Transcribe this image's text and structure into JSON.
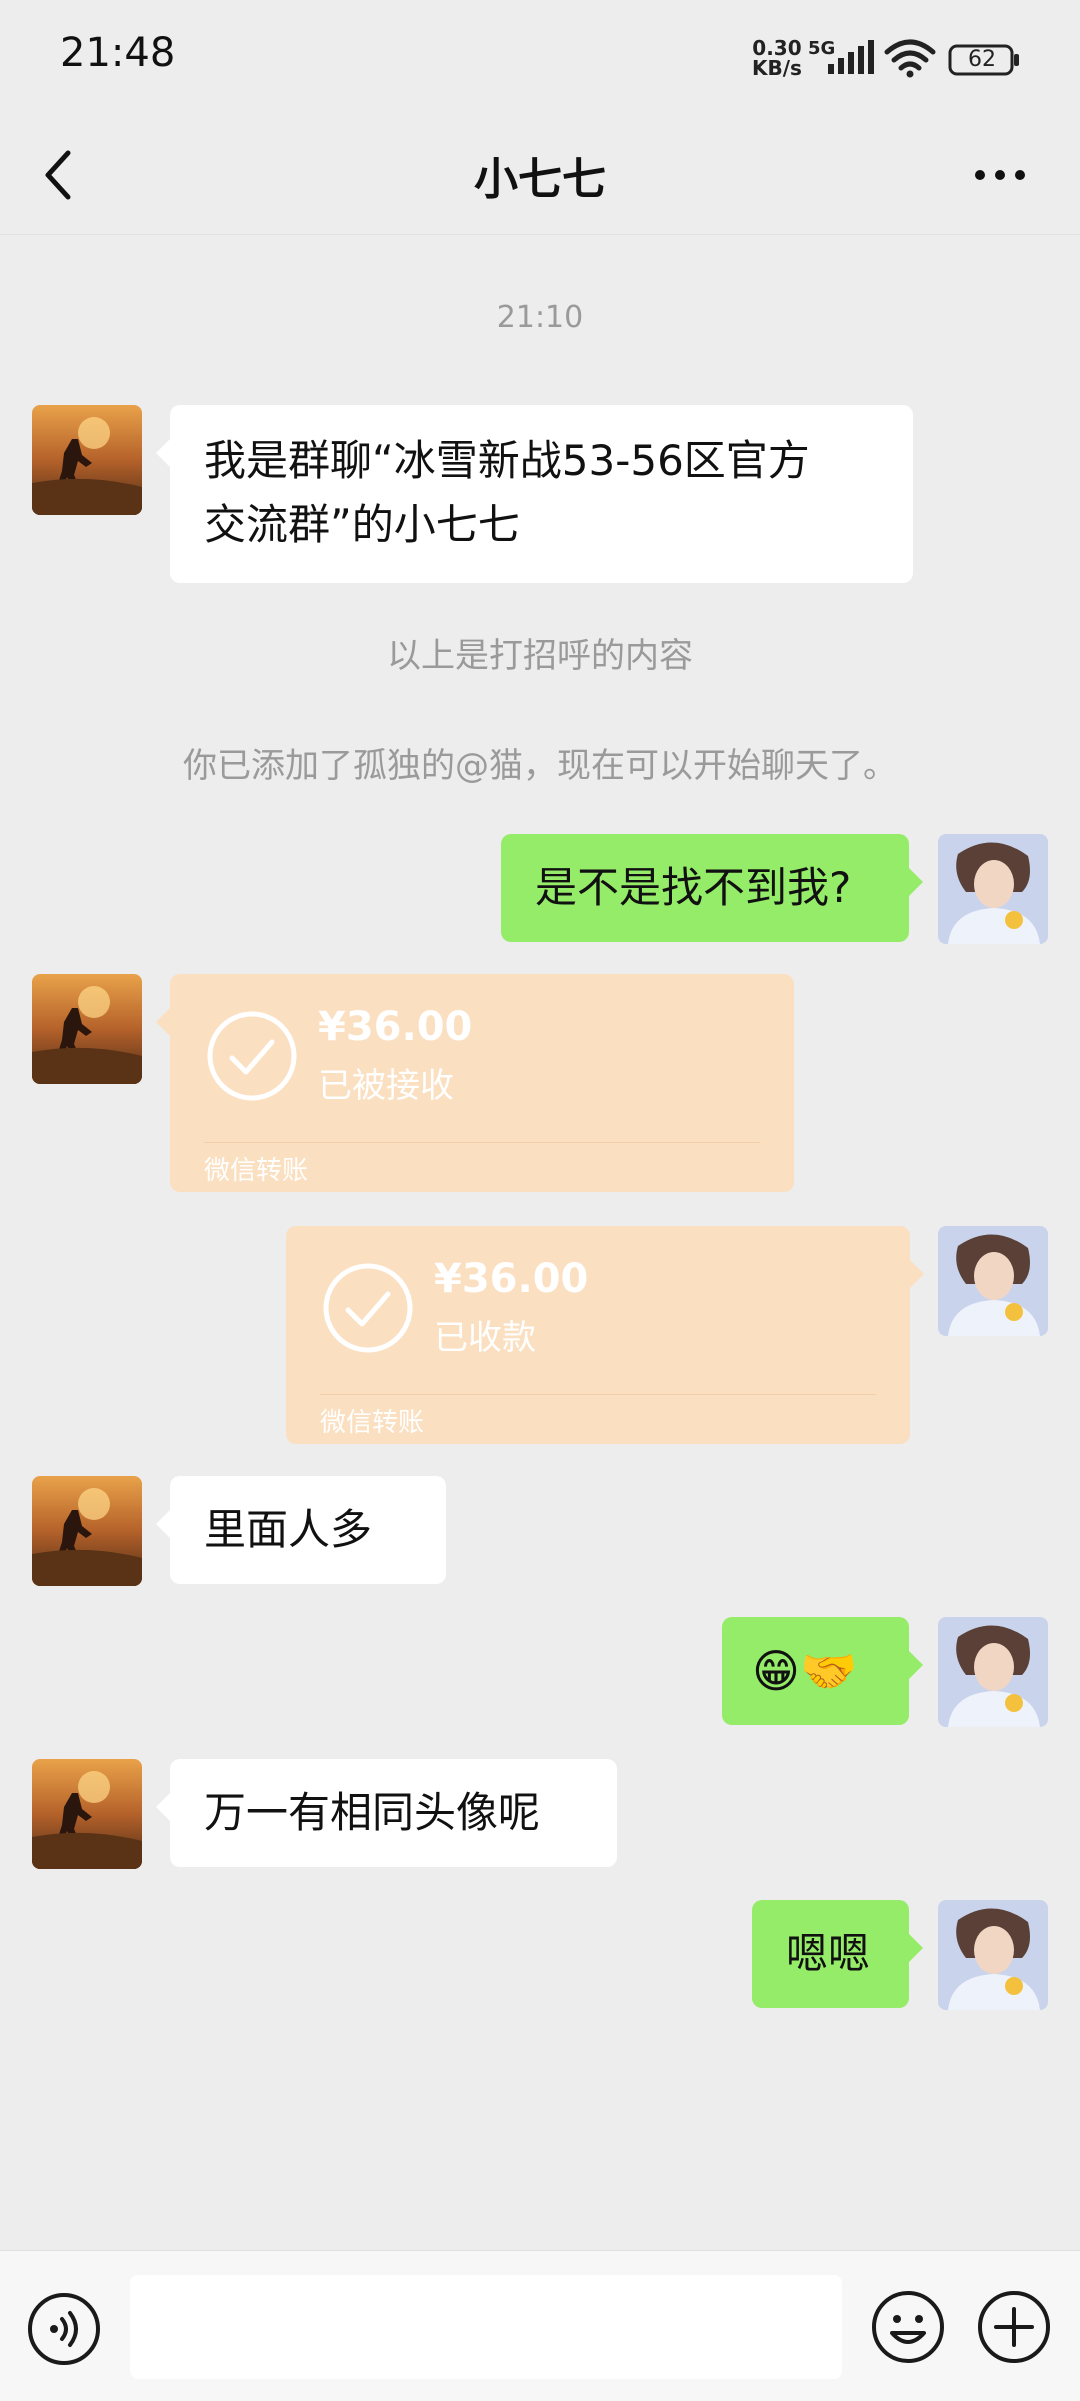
{
  "status_bar": {
    "time": "21:48",
    "net_speed_value": "0.30",
    "net_speed_unit": "KB/s",
    "network": "5G",
    "battery": "62"
  },
  "header": {
    "title": "小七七",
    "back_icon": "chevron-left-icon",
    "more_icon": "more-dots-icon"
  },
  "chat": {
    "timestamp": "21:10",
    "greeting_line1": "我是群聊“冰雪新战53-56区官方",
    "greeting_line2": "交流群”的小七七",
    "system_1": "以上是打招呼的内容",
    "system_2": "你已添加了孤独的@猫，现在可以开始聊天了。",
    "msg_1": "是不是找不到我?",
    "transfer_1": {
      "amount": "¥36.00",
      "status": "已被接收",
      "label": "微信转账"
    },
    "transfer_2": {
      "amount": "¥36.00",
      "status": "已收款",
      "label": "微信转账"
    },
    "msg_2": "里面人多",
    "msg_3": "😁🤝",
    "msg_4": "万一有相同头像呢",
    "msg_5": "嗯嗯"
  },
  "colors": {
    "background": "#ededed",
    "self_bubble": "#95ec69",
    "other_bubble": "#ffffff",
    "transfer": "#fbdfc1"
  }
}
